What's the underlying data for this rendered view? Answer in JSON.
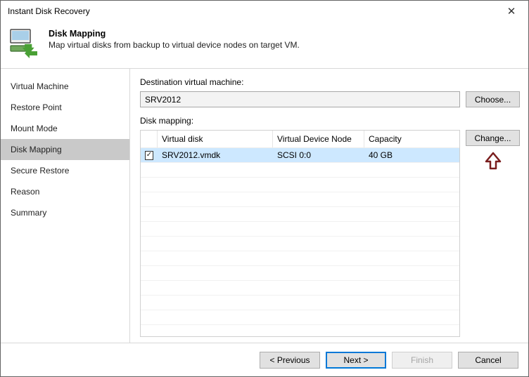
{
  "window": {
    "title": "Instant Disk Recovery"
  },
  "header": {
    "title": "Disk Mapping",
    "subtitle": "Map virtual disks from backup to virtual device nodes on target VM."
  },
  "sidebar": {
    "items": [
      {
        "label": "Virtual Machine"
      },
      {
        "label": "Restore Point"
      },
      {
        "label": "Mount Mode"
      },
      {
        "label": "Disk Mapping"
      },
      {
        "label": "Secure Restore"
      },
      {
        "label": "Reason"
      },
      {
        "label": "Summary"
      }
    ],
    "selected_index": 3
  },
  "content": {
    "destination_label": "Destination virtual machine:",
    "destination_value": "SRV2012",
    "choose_label": "Choose...",
    "mapping_label": "Disk mapping:",
    "change_label": "Change...",
    "grid": {
      "columns": [
        "",
        "Virtual disk",
        "Virtual Device Node",
        "Capacity"
      ],
      "rows": [
        {
          "checked": true,
          "virtual_disk": "SRV2012.vmdk",
          "node": "SCSI 0:0",
          "capacity": "40 GB"
        }
      ]
    }
  },
  "footer": {
    "previous": "< Previous",
    "next": "Next >",
    "finish": "Finish",
    "cancel": "Cancel"
  }
}
